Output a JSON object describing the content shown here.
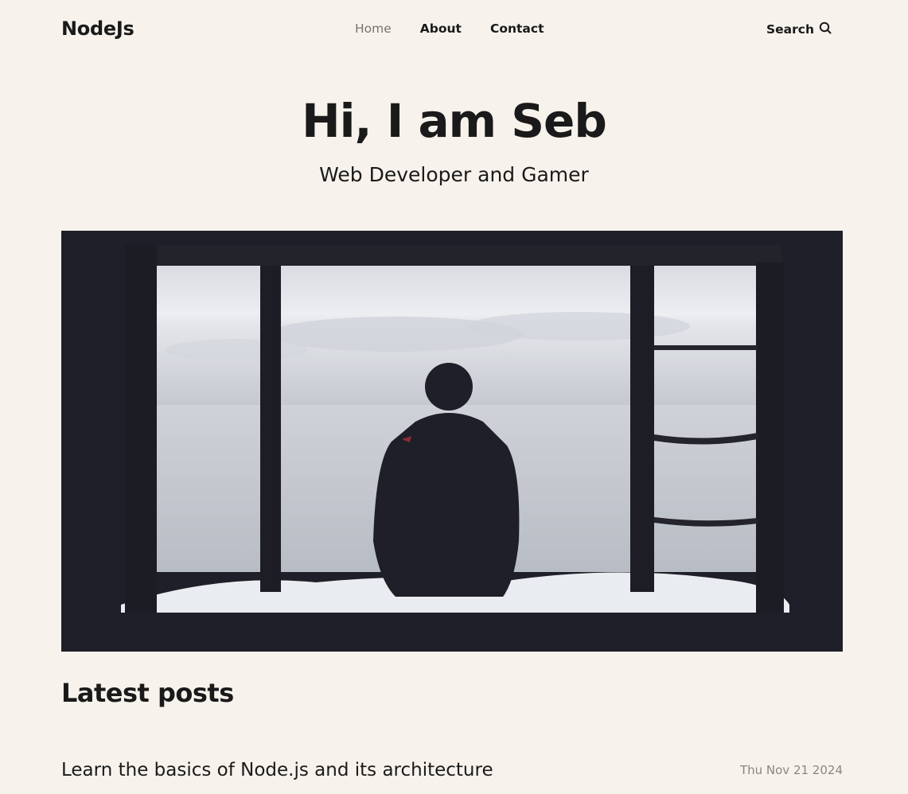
{
  "header": {
    "logo": "NodeJs",
    "nav": [
      {
        "label": "Home",
        "active": true
      },
      {
        "label": "About",
        "active": false
      },
      {
        "label": "Contact",
        "active": false
      }
    ],
    "search_label": "Search",
    "search_icon": "search-icon"
  },
  "hero": {
    "title": "Hi, I am Seb",
    "subtitle": "Web Developer and Gamer"
  },
  "latest": {
    "heading": "Latest posts",
    "posts": [
      {
        "title": "Learn the basics of Node.js and its architecture",
        "date": "Thu Nov 21 2024"
      }
    ]
  },
  "colors": {
    "background": "#f7f3ec",
    "text": "#1a1a1a",
    "muted": "#8a8680",
    "image_frame": "#1e1f28"
  }
}
